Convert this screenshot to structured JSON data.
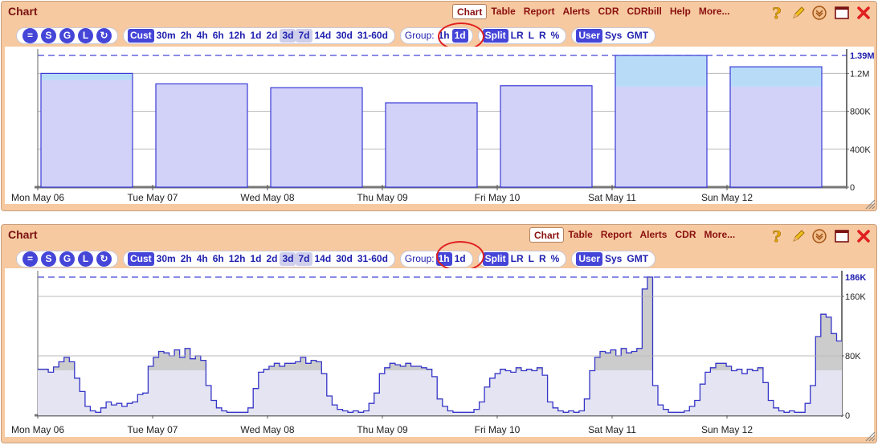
{
  "panels": [
    {
      "title": "Chart",
      "menu": [
        "Chart",
        "Table",
        "Report",
        "Alerts",
        "CDR",
        "CDRbill",
        "Help",
        "More..."
      ],
      "toolbar": {
        "circles": [
          "=",
          "S",
          "G",
          "L",
          "↻"
        ],
        "ranges": [
          "Cust",
          "30m",
          "2h",
          "4h",
          "6h",
          "12h",
          "1d",
          "2d",
          "3d",
          "7d",
          "14d",
          "30d",
          "31-60d"
        ],
        "range_selected": "Cust",
        "range_highlight": [
          "3d",
          "7d"
        ],
        "group_label": "Group:",
        "group": [
          "1h",
          "1d"
        ],
        "group_selected": "1d",
        "split": [
          "Split",
          "LR",
          "L",
          "R",
          "%"
        ],
        "split_selected": "Split",
        "tz": [
          "User",
          "Sys",
          "GMT"
        ],
        "tz_selected": "User"
      }
    },
    {
      "title": "Chart",
      "menu": [
        "Chart",
        "Table",
        "Report",
        "Alerts",
        "CDR",
        "More..."
      ],
      "toolbar": {
        "circles": [
          "=",
          "S",
          "G",
          "L",
          "↻"
        ],
        "ranges": [
          "Cust",
          "30m",
          "2h",
          "4h",
          "6h",
          "12h",
          "1d",
          "2d",
          "3d",
          "7d",
          "14d",
          "30d",
          "31-60d"
        ],
        "range_selected": "Cust",
        "range_highlight": [
          "3d",
          "7d"
        ],
        "group_label": "Group:",
        "group": [
          "1h",
          "1d"
        ],
        "group_selected": "1h",
        "split": [
          "Split",
          "LR",
          "L",
          "R",
          "%"
        ],
        "split_selected": "Split",
        "tz": [
          "User",
          "Sys",
          "GMT"
        ],
        "tz_selected": "User"
      }
    }
  ],
  "colors": {
    "fill_main": "#d2d2f8",
    "fill_top": "#b8dcf8",
    "stroke": "#3a3ad8",
    "area_light": "#e4e4f2",
    "area_dark": "#cccccc",
    "area_stroke": "#3535c8",
    "accent": "#4545d8",
    "title": "#7a1212",
    "annotation": "#e02020"
  },
  "chart_data": [
    {
      "type": "bar",
      "categories": [
        "Mon May 06",
        "Tue May 07",
        "Wed May 08",
        "Thu May 09",
        "Fri May 10",
        "Sat May 11",
        "Sun May 12"
      ],
      "series": [
        {
          "values": [
            1130000,
            1090000,
            1050000,
            890000,
            1070000,
            1060000,
            1060000
          ]
        },
        {
          "values": [
            70000,
            0,
            0,
            0,
            0,
            330000,
            210000
          ]
        }
      ],
      "ylim": [
        0,
        1390000
      ],
      "yticks": [
        "1.2M",
        "800K",
        "400K",
        "0"
      ],
      "max_label": "1.39M",
      "max_value": 1390000,
      "grid": true
    },
    {
      "type": "area",
      "categories": [
        "Mon May 06",
        "Tue May 07",
        "Wed May 08",
        "Thu May 09",
        "Fri May 10",
        "Sat May 11",
        "Sun May 12"
      ],
      "series": [
        {
          "values": [
            62000,
            62000,
            58000,
            65000,
            72000,
            78000,
            72000,
            50000,
            32000,
            12000,
            6000,
            4000,
            10000,
            18000,
            14000,
            16000,
            12000,
            16000,
            18000,
            28000,
            30000,
            66000,
            78000,
            86000,
            84000,
            80000,
            88000,
            78000,
            90000,
            76000,
            80000,
            74000,
            40000,
            20000,
            10000,
            6000,
            4000,
            4000,
            4000,
            4000,
            10000,
            36000,
            58000,
            62000,
            66000,
            70000,
            66000,
            70000,
            70000,
            72000,
            78000,
            70000,
            74000,
            72000,
            56000,
            26000,
            14000,
            8000,
            6000,
            4000,
            6000,
            4000,
            6000,
            16000,
            30000,
            56000,
            64000,
            70000,
            68000,
            66000,
            70000,
            66000,
            66000,
            64000,
            62000,
            52000,
            22000,
            12000,
            6000,
            4000,
            4000,
            4000,
            4000,
            8000,
            18000,
            38000,
            50000,
            56000,
            62000,
            60000,
            58000,
            64000,
            60000,
            62000,
            60000,
            64000,
            54000,
            18000,
            10000,
            6000,
            4000,
            6000,
            4000,
            6000,
            22000,
            60000,
            78000,
            86000,
            84000,
            88000,
            80000,
            90000,
            84000,
            86000,
            90000,
            170000,
            186000,
            40000,
            14000,
            8000,
            4000,
            4000,
            4000,
            6000,
            12000,
            20000,
            42000,
            58000,
            64000,
            70000,
            70000,
            66000,
            60000,
            62000,
            56000,
            62000,
            60000,
            64000,
            44000,
            20000,
            10000,
            6000,
            4000,
            6000,
            4000,
            4000,
            16000,
            40000,
            106000,
            136000,
            132000,
            110000,
            100000
          ]
        },
        {
          "values": [
            0,
            0,
            0,
            0,
            0,
            0,
            0,
            0,
            0,
            0,
            0,
            0,
            0,
            0,
            0,
            0,
            0,
            0,
            0,
            0,
            0,
            0,
            0,
            0,
            0,
            0,
            0,
            0,
            0,
            0,
            0,
            0,
            0,
            0,
            0,
            0,
            0,
            0,
            0,
            0,
            0,
            0,
            0,
            0,
            0,
            0,
            0,
            0,
            0,
            0,
            0,
            0,
            0,
            0,
            0,
            0,
            0,
            0,
            0,
            0,
            0,
            0,
            0,
            0,
            0,
            0,
            0,
            0,
            0,
            0,
            0,
            0,
            0,
            0,
            0,
            0,
            0,
            0,
            0,
            0,
            0,
            0,
            0,
            0,
            0,
            0,
            0,
            0,
            0,
            0,
            0,
            0,
            0,
            0,
            0,
            0,
            0,
            0,
            0,
            0,
            0,
            0,
            0,
            0,
            0,
            0,
            0,
            0,
            0,
            0,
            0,
            0,
            0,
            0,
            0,
            0,
            0,
            0,
            0,
            0,
            0,
            0,
            0,
            0,
            0,
            0,
            0,
            0,
            0,
            0,
            0,
            0,
            0,
            0,
            0,
            0,
            0,
            0,
            0,
            0,
            0,
            0,
            0,
            0,
            0,
            0,
            0,
            0,
            0,
            0,
            0,
            0,
            0,
            0,
            0,
            0,
            0,
            0
          ]
        }
      ],
      "ylim": [
        0,
        186000
      ],
      "yticks": [
        "160K",
        "80K",
        "0"
      ],
      "max_label": "186K",
      "max_value": 186000,
      "grid": true
    }
  ]
}
